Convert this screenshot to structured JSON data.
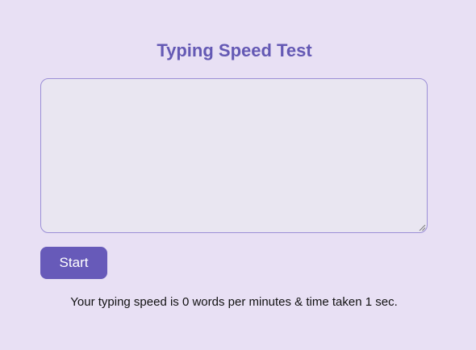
{
  "app": {
    "title": "Typing Speed Test"
  },
  "typing_area": {
    "value": "",
    "placeholder": ""
  },
  "controls": {
    "start_label": "Start"
  },
  "result": {
    "text": "Your typing speed is 0 words per minutes & time taken 1 sec."
  },
  "colors": {
    "background": "#e8e0f4",
    "accent": "#675ab9",
    "title": "#6459b4",
    "textarea_border": "#9b8fd6"
  }
}
